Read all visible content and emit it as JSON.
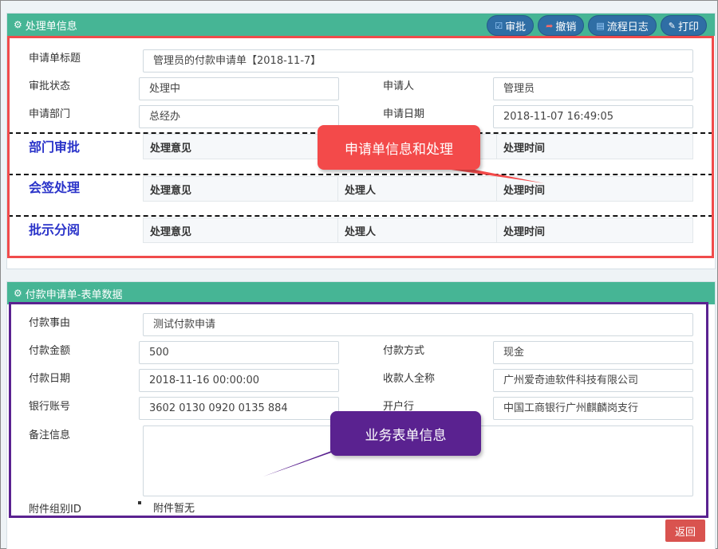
{
  "panel1": {
    "title": "处理单信息",
    "toolbar": {
      "approve": "审批",
      "revoke": "撤销",
      "flowlog": "流程日志",
      "print": "打印"
    },
    "fields": {
      "title_label": "申请单标题",
      "title_value": "管理员的付款申请单【2018-11-7】",
      "status_label": "审批状态",
      "status_value": "处理中",
      "applicant_label": "申请人",
      "applicant_value": "管理员",
      "dept_label": "申请部门",
      "dept_value": "总经办",
      "date_label": "申请日期",
      "date_value": "2018-11-07 16:49:05"
    },
    "sections": [
      {
        "title": "部门审批",
        "cols": [
          "处理意见",
          "",
          "处理时间"
        ]
      },
      {
        "title": "会签处理",
        "cols": [
          "处理意见",
          "处理人",
          "处理时间"
        ]
      },
      {
        "title": "批示分阅",
        "cols": [
          "处理意见",
          "处理人",
          "处理时间"
        ]
      }
    ]
  },
  "panel2": {
    "title": "付款申请单-表单数据",
    "fields": {
      "reason_label": "付款事由",
      "reason_value": "测试付款申请",
      "amount_label": "付款金额",
      "amount_value": "500",
      "method_label": "付款方式",
      "method_value": "现金",
      "paydate_label": "付款日期",
      "paydate_value": "2018-11-16 00:00:00",
      "payee_label": "收款人全称",
      "payee_value": "广州爱奇迪软件科技有限公司",
      "account_label": "银行账号",
      "account_value": "3602 0130 0920 0135 884",
      "bank_label": "开户行",
      "bank_value": "中国工商银行广州麒麟岗支行",
      "remark_label": "备注信息",
      "remark_value": "",
      "attach_label": "附件组别ID",
      "attach_value": "附件暂无"
    }
  },
  "callouts": {
    "red": "申请单信息和处理",
    "purple": "业务表单信息"
  },
  "back_button": "返回",
  "colors": {
    "header_green": "#46b595",
    "toolbar_blue": "#2f6ea5",
    "callout_red": "#f34a4a",
    "callout_purple": "#5a2290",
    "section_title_blue": "#2a33c9",
    "back_red": "#d9534f"
  }
}
